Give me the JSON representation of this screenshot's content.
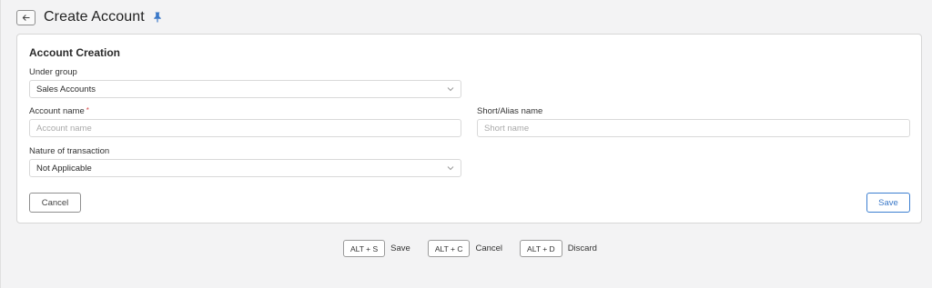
{
  "header": {
    "title": "Create Account",
    "back_icon": "arrow-left-icon",
    "pin_icon": "pin-icon",
    "pin_color": "#3a78c8"
  },
  "form": {
    "section_title": "Account Creation",
    "under_group": {
      "label": "Under group",
      "value": "Sales Accounts"
    },
    "account_name": {
      "label": "Account name",
      "required_mark": "*",
      "placeholder": "Account name",
      "value": ""
    },
    "short_name": {
      "label": "Short/Alias name",
      "placeholder": "Short name",
      "value": ""
    },
    "nature_of_transaction": {
      "label": "Nature of transaction",
      "value": "Not Applicable"
    },
    "cancel_label": "Cancel",
    "save_label": "Save"
  },
  "shortcuts": [
    {
      "key": "ALT + S",
      "label": "Save"
    },
    {
      "key": "ALT + C",
      "label": "Cancel"
    },
    {
      "key": "ALT + D",
      "label": "Discard"
    }
  ],
  "colors": {
    "accent": "#3a78c8",
    "required": "#d84a4a",
    "background": "#f3f3f4"
  }
}
